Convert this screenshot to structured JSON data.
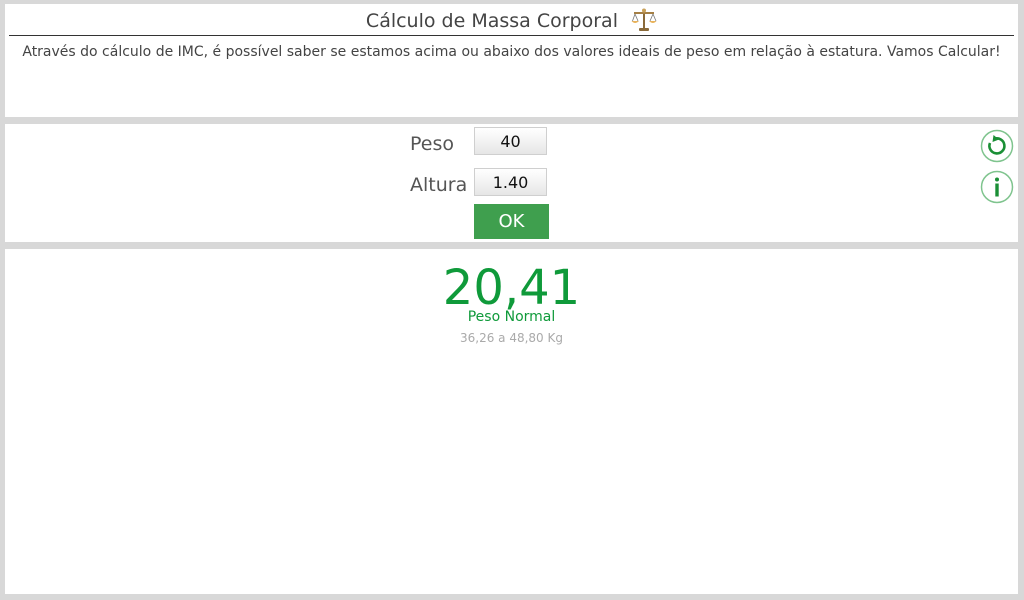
{
  "header": {
    "title": "Cálculo de Massa Corporal",
    "title_icon": "balance-scale-icon",
    "description": "Através do cálculo de IMC, é possível saber se estamos acima ou abaixo dos valores ideais de peso em relação à estatura. Vamos Calcular!"
  },
  "form": {
    "weight_label": "Peso",
    "weight_value": "40",
    "height_label": "Altura",
    "height_value": "1.40",
    "ok_label": "OK",
    "side_icons": [
      "refresh-icon",
      "info-icon"
    ]
  },
  "result": {
    "bmi": "20,41",
    "classification": "Peso Normal",
    "ideal_range": "36,26 a 48,80 Kg"
  },
  "colors": {
    "accent_green": "#0f9a3a",
    "button_green": "#3f9f4e",
    "background": "#d8d8d8"
  }
}
